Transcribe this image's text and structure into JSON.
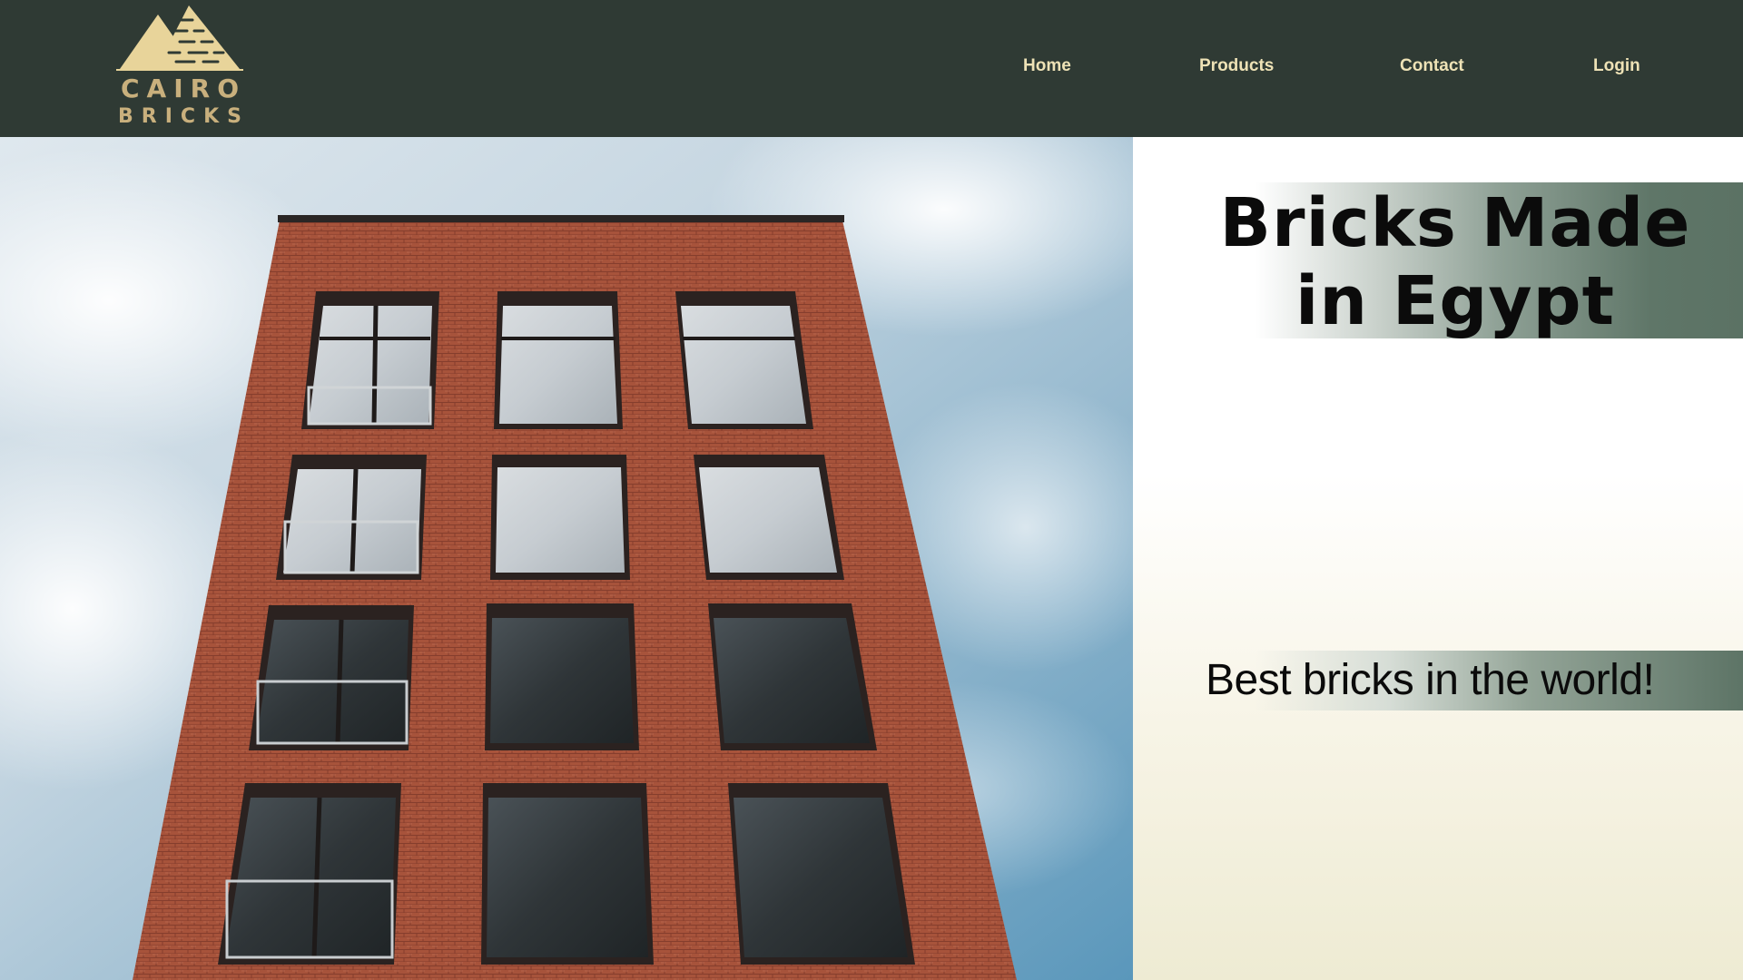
{
  "brand": {
    "logo_word1": "CAIRO",
    "logo_word2": "BRICKS",
    "logo_color": "#e8d49a",
    "text_color": "#c9b07d"
  },
  "nav": {
    "items": [
      {
        "label": "Home"
      },
      {
        "label": "Products"
      },
      {
        "label": "Contact"
      },
      {
        "label": "Login"
      }
    ],
    "text_color": "#eee2b6"
  },
  "hero": {
    "headline_line1": "Bricks Made",
    "headline_line2": "in Egypt",
    "tagline": "Best bricks in the world!",
    "accent_color": "#5b7264",
    "header_bg": "#2f3a34"
  },
  "icons": {
    "logo": "pyramids-icon"
  }
}
